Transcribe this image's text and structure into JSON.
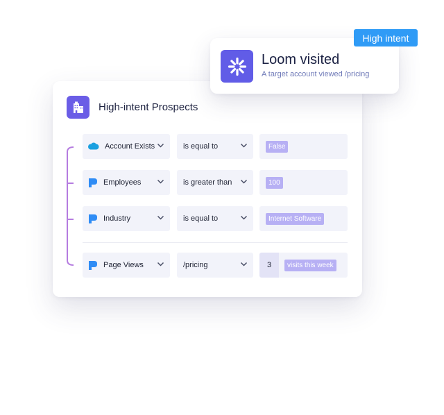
{
  "segment": {
    "title": "High-intent Prospects",
    "icon": "building-icon"
  },
  "rules": [
    {
      "source_icon": "salesforce-cloud-icon",
      "field": "Account Exists",
      "operator": "is equal to",
      "value": "False"
    },
    {
      "source_icon": "brand-p-icon",
      "field": "Employees",
      "operator": "is greater than",
      "value": "100"
    },
    {
      "source_icon": "brand-p-icon",
      "field": "Industry",
      "operator": "is equal to",
      "value": "Internet Software"
    },
    {
      "source_icon": "brand-p-icon",
      "field": "Page Views",
      "operator": "/pricing",
      "count": "3",
      "value": "visits this week"
    }
  ],
  "notification": {
    "title": "Loom visited",
    "subtitle": "A target account viewed /pricing",
    "icon": "loom-burst-icon"
  },
  "badge": {
    "label": "High intent"
  },
  "colors": {
    "accent": "#6a5de6",
    "loom": "#615ce7",
    "badge": "#2f9bf6",
    "bracket": "#b57ce0",
    "chip": "#b7b0f4",
    "salesforce": "#1aa0e0",
    "brand_p": "#2f8cf5"
  }
}
